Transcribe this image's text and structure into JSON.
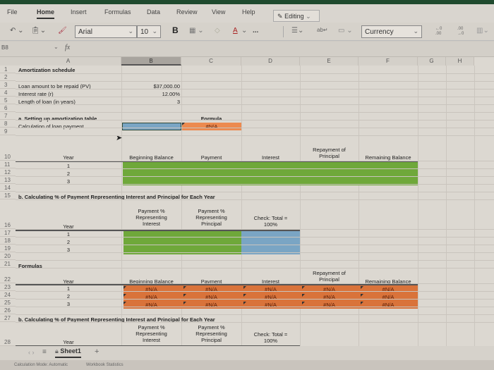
{
  "ribbon_tabs": [
    "File",
    "Home",
    "Insert",
    "Formulas",
    "Data",
    "Review",
    "View",
    "Help"
  ],
  "active_tab": "Home",
  "editing_mode": "Editing",
  "toolbar": {
    "font_name": "Arial",
    "font_size": "10",
    "bold_label": "B",
    "more_label": "...",
    "number_format": "Currency",
    "increase_decimal": "←0 .00",
    "decrease_decimal": ".00 →0",
    "underline_a": "A"
  },
  "formula_bar": {
    "name_box": "B8",
    "fx_label": "fx",
    "value": ""
  },
  "columns": [
    "A",
    "B",
    "C",
    "D",
    "E",
    "F",
    "G",
    "H"
  ],
  "selected_column": "B",
  "rows": [
    "1",
    "2",
    "3",
    "4",
    "5",
    "6",
    "7",
    "8",
    "9",
    "10",
    "11",
    "12",
    "13",
    "14",
    "15",
    "16",
    "17",
    "18",
    "19",
    "20",
    "21",
    "22",
    "23",
    "24",
    "25",
    "26",
    "27",
    "28"
  ],
  "sheet": {
    "title": "Amortization schedule",
    "pv_label": "Loan amount to be repaid (PV)",
    "pv_value": "$37,000.00",
    "rate_label": "Interest rate (r)",
    "rate_value": "12.00%",
    "length_label": "Length of loan (in years)",
    "length_value": "3",
    "section_a": "a.  Setting up amortization table",
    "calc_label": "Calculation of loan payment",
    "formula_header": "Formula",
    "formula_value": "#N/A",
    "table1_headers": {
      "year": "Year",
      "beginning_balance": "Beginning Balance",
      "payment": "Payment",
      "interest": "Interest",
      "repayment_line1": "Repayment of",
      "repayment_line2": "Principal",
      "remaining_balance": "Remaining Balance"
    },
    "years": [
      "1",
      "2",
      "3"
    ],
    "section_b": "b.  Calculating % of Payment Representing Interest and Principal for Each Year",
    "table2_headers": {
      "year": "Year",
      "pct_interest": [
        "Payment %",
        "Representing",
        "Interest"
      ],
      "pct_principal": [
        "Payment %",
        "Representing",
        "Principal"
      ],
      "check": [
        "Check:  Total =",
        "100%"
      ]
    },
    "formulas_label": "Formulas",
    "formula_rows": [
      [
        "#N/A",
        "#N/A",
        "#N/A",
        "#N/A",
        "#N/A"
      ],
      [
        "#N/A",
        "#N/A",
        "#N/A",
        "#N/A",
        "#N/A"
      ],
      [
        "#N/A",
        "#N/A",
        "#N/A",
        "#N/A",
        "#N/A"
      ]
    ]
  },
  "sheet_tabs": {
    "active": "Sheet1",
    "add_label": "+",
    "menu_label": "≡"
  },
  "status": {
    "calc_mode": "Calculation Mode: Automatic",
    "workbook_stats": "Workbook Statistics"
  },
  "colors": {
    "input_green": "#6fa83a",
    "input_blue": "#7aa5c4",
    "formula_orange": "#d9733a",
    "error_text": "#5a1f08"
  }
}
